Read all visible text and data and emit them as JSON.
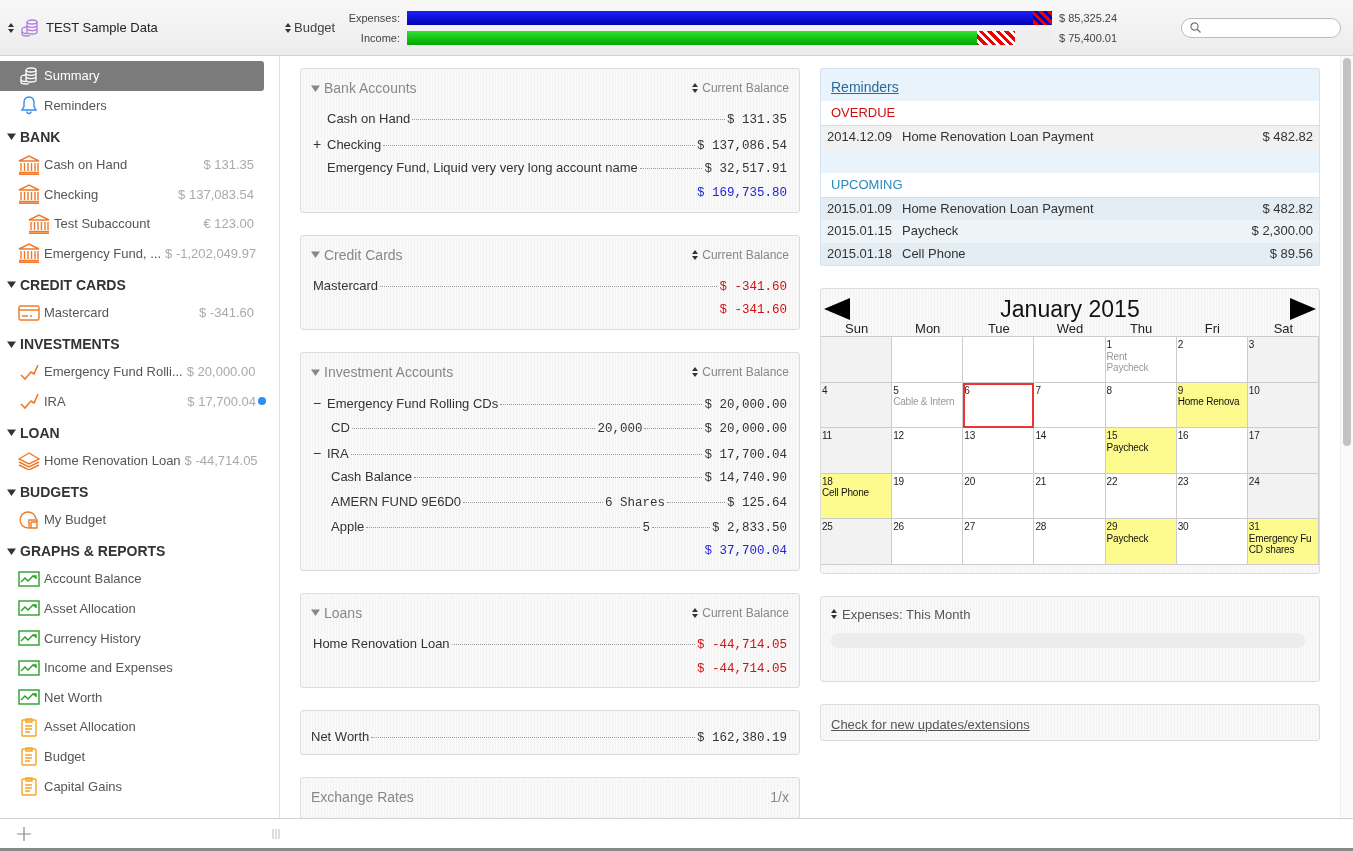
{
  "toolbar": {
    "file": {
      "label": "TEST Sample Data"
    },
    "budget": {
      "label": "Budget"
    },
    "bars": [
      {
        "kind": "expenses",
        "label": "Expenses:",
        "level": 0.97,
        "hatch": {
          "level": 1.0
        },
        "amount": "$ 85,325.24"
      },
      {
        "kind": "income",
        "label": "Income:",
        "level": 0.884,
        "hatch": {
          "level": 0.943
        },
        "amount": "$ 75,400.01"
      }
    ]
  },
  "sidebar": {
    "items": [
      {
        "kind": "coins",
        "label": "Summary",
        "selected": true
      },
      {
        "kind": "bell",
        "label": "Reminders",
        "selected": false
      }
    ],
    "sections": [
      {
        "title": "BANK",
        "expanded": true,
        "items": [
          {
            "kind": "bank",
            "label": "Cash on Hand",
            "amount": "$ 131.35",
            "dot": false,
            "selected": false
          },
          {
            "kind": "bank",
            "label": "Checking",
            "amount": "$ 137,083.54",
            "dot": false,
            "selected": false,
            "children": [
              {
                "kind": "bank",
                "label": "Test Subaccount",
                "amount": "€ 123.00",
                "dot": false,
                "selected": false
              }
            ]
          },
          {
            "kind": "bank",
            "label": "Emergency Fund, ...",
            "amount": "$ -1,202,049.97",
            "dot": false,
            "selected": false
          }
        ]
      },
      {
        "title": "CREDIT CARDS",
        "expanded": true,
        "items": [
          {
            "kind": "card",
            "label": "Mastercard",
            "amount": "$ -341.60",
            "dot": false,
            "selected": false
          }
        ]
      },
      {
        "title": "INVESTMENTS",
        "expanded": true,
        "items": [
          {
            "kind": "invest",
            "label": "Emergency Fund Rolli...",
            "amount": "$ 20,000.00",
            "dot": false,
            "selected": false
          },
          {
            "kind": "invest",
            "label": "IRA",
            "amount": "$ 17,700.04",
            "dot": true,
            "selected": false
          }
        ]
      },
      {
        "title": "LOAN",
        "expanded": true,
        "items": [
          {
            "kind": "loan",
            "label": "Home Renovation Loan",
            "amount": "$ -44,714.05",
            "dot": false,
            "selected": false
          }
        ]
      },
      {
        "title": "BUDGETS",
        "expanded": true,
        "items": [
          {
            "kind": "budget",
            "label": "My Budget",
            "dot": false,
            "selected": false
          }
        ]
      },
      {
        "title": "GRAPHS & REPORTS",
        "expanded": true,
        "items": [
          {
            "kind": "graph",
            "label": "Account Balance",
            "dot": false,
            "selected": false
          },
          {
            "kind": "graph",
            "label": "Asset Allocation",
            "dot": false,
            "selected": false
          },
          {
            "kind": "graph",
            "label": "Currency History",
            "dot": false,
            "selected": false
          },
          {
            "kind": "graph",
            "label": "Income and Expenses",
            "dot": false,
            "selected": false
          },
          {
            "kind": "graph",
            "label": "Net Worth",
            "dot": false,
            "selected": false
          },
          {
            "kind": "report",
            "label": "Asset Allocation",
            "dot": false,
            "selected": false
          },
          {
            "kind": "report",
            "label": "Budget",
            "dot": false,
            "selected": false
          },
          {
            "kind": "report",
            "label": "Capital Gains",
            "dot": false,
            "selected": false
          }
        ]
      }
    ]
  },
  "panels": [
    {
      "title": "Bank Accounts",
      "expanded": true,
      "sort_label": "Current Balance",
      "rows": [
        {
          "name": "Cash on Hand",
          "amount": "$ 131.35",
          "negative": false
        },
        {
          "toggle": "+",
          "name": "Checking",
          "amount": "$ 137,086.54",
          "negative": false
        },
        {
          "name": "Emergency Fund, Liquid very very long account name",
          "amount": "$ 32,517.91",
          "negative": false
        }
      ],
      "total": {
        "amount": "$ 169,735.80",
        "negative": false
      }
    },
    {
      "title": "Credit Cards",
      "expanded": true,
      "sort_label": "Current Balance",
      "rows": [
        {
          "name": "Mastercard",
          "amount": "$ -341.60",
          "negative": true
        }
      ],
      "total": {
        "amount": "$ -341.60",
        "negative": true
      }
    },
    {
      "title": "Investment Accounts",
      "expanded": true,
      "sort_label": "Current Balance",
      "rows": [
        {
          "toggle": "−",
          "name": "Emergency Fund Rolling CDs",
          "amount": "$ 20,000.00",
          "negative": false,
          "children": [
            {
              "name": "CD",
              "quantity": "20,000",
              "amount": "$ 20,000.00",
              "negative": false
            }
          ]
        },
        {
          "toggle": "−",
          "name": "IRA",
          "amount": "$ 17,700.04",
          "negative": false,
          "children": [
            {
              "name": "Cash Balance",
              "amount": "$ 14,740.90",
              "negative": false
            },
            {
              "name": "AMERN FUND 9E6D0",
              "quantity": "6 Shares",
              "amount": "$ 125.64",
              "negative": false
            },
            {
              "name": "Apple",
              "quantity": "5",
              "amount": "$ 2,833.50",
              "negative": false
            }
          ]
        }
      ],
      "total": {
        "amount": "$ 37,700.04",
        "negative": false
      }
    },
    {
      "title": "Loans",
      "expanded": true,
      "sort_label": "Current Balance",
      "rows": [
        {
          "name": "Home Renovation Loan",
          "amount": "$ -44,714.05",
          "negative": true
        }
      ],
      "total": {
        "amount": "$ -44,714.05",
        "negative": true
      }
    }
  ],
  "net_worth": {
    "label": "Net Worth",
    "amount": "$ 162,380.19"
  },
  "exchange_rates": {
    "title": "Exchange Rates",
    "column": "1/x"
  },
  "reminders": {
    "title": "Reminders",
    "groups": [
      {
        "kind": "overdue",
        "title": "OVERDUE",
        "rows": [
          {
            "date": "2014.12.09",
            "name": "Home Renovation Loan Payment",
            "amount": "$ 482.82"
          }
        ]
      },
      {
        "kind": "upcoming",
        "title": "UPCOMING",
        "rows": [
          {
            "date": "2015.01.09",
            "name": "Home Renovation Loan Payment",
            "amount": "$ 482.82"
          },
          {
            "date": "2015.01.15",
            "name": "Paycheck",
            "amount": "$ 2,300.00"
          },
          {
            "date": "2015.01.18",
            "name": "Cell Phone",
            "amount": "$ 89.56"
          }
        ]
      }
    ]
  },
  "calendar": {
    "title": "January 2015",
    "weekdays": [
      "Sun",
      "Mon",
      "Tue",
      "Wed",
      "Thu",
      "Fri",
      "Sat"
    ],
    "weeks": [
      [
        {
          "kind": "blank"
        },
        {
          "kind": "blank"
        },
        {
          "kind": "blank"
        },
        {
          "kind": "blank"
        },
        {
          "kind": "day",
          "day": "1",
          "events": [
            "Rent",
            "Paycheck"
          ],
          "highlight": false,
          "today": false
        },
        {
          "kind": "day",
          "day": "2",
          "highlight": false,
          "today": false
        },
        {
          "kind": "day",
          "day": "3",
          "highlight": false,
          "today": false
        }
      ],
      [
        {
          "kind": "day",
          "day": "4",
          "highlight": false,
          "today": false
        },
        {
          "kind": "day",
          "day": "5",
          "events": [
            "Cable & Intern"
          ],
          "highlight": false,
          "today": false
        },
        {
          "kind": "day",
          "day": "6",
          "highlight": false,
          "today": true
        },
        {
          "kind": "day",
          "day": "7",
          "highlight": false,
          "today": false
        },
        {
          "kind": "day",
          "day": "8",
          "highlight": false,
          "today": false
        },
        {
          "kind": "day",
          "day": "9",
          "events": [
            "Home Renova"
          ],
          "highlight": true,
          "today": false
        },
        {
          "kind": "day",
          "day": "10",
          "highlight": false,
          "today": false
        }
      ],
      [
        {
          "kind": "day",
          "day": "11",
          "highlight": false,
          "today": false
        },
        {
          "kind": "day",
          "day": "12",
          "highlight": false,
          "today": false
        },
        {
          "kind": "day",
          "day": "13",
          "highlight": false,
          "today": false
        },
        {
          "kind": "day",
          "day": "14",
          "highlight": false,
          "today": false
        },
        {
          "kind": "day",
          "day": "15",
          "events": [
            "Paycheck"
          ],
          "highlight": true,
          "today": false
        },
        {
          "kind": "day",
          "day": "16",
          "highlight": false,
          "today": false
        },
        {
          "kind": "day",
          "day": "17",
          "highlight": false,
          "today": false
        }
      ],
      [
        {
          "kind": "day",
          "day": "18",
          "events": [
            "Cell Phone"
          ],
          "highlight": true,
          "today": false
        },
        {
          "kind": "day",
          "day": "19",
          "highlight": false,
          "today": false
        },
        {
          "kind": "day",
          "day": "20",
          "highlight": false,
          "today": false
        },
        {
          "kind": "day",
          "day": "21",
          "highlight": false,
          "today": false
        },
        {
          "kind": "day",
          "day": "22",
          "highlight": false,
          "today": false
        },
        {
          "kind": "day",
          "day": "23",
          "highlight": false,
          "today": false
        },
        {
          "kind": "day",
          "day": "24",
          "highlight": false,
          "today": false
        }
      ],
      [
        {
          "kind": "day",
          "day": "25",
          "highlight": false,
          "today": false
        },
        {
          "kind": "day",
          "day": "26",
          "highlight": false,
          "today": false
        },
        {
          "kind": "day",
          "day": "27",
          "highlight": false,
          "today": false
        },
        {
          "kind": "day",
          "day": "28",
          "highlight": false,
          "today": false
        },
        {
          "kind": "day",
          "day": "29",
          "events": [
            "Paycheck"
          ],
          "highlight": true,
          "today": false
        },
        {
          "kind": "day",
          "day": "30",
          "highlight": false,
          "today": false
        },
        {
          "kind": "day",
          "day": "31",
          "events": [
            "Emergency Fu",
            "CD shares"
          ],
          "highlight": true,
          "today": false
        }
      ]
    ]
  },
  "expenses_chart": {
    "title": "Expenses: This Month"
  },
  "updates": {
    "link": "Check for new updates/extensions"
  }
}
